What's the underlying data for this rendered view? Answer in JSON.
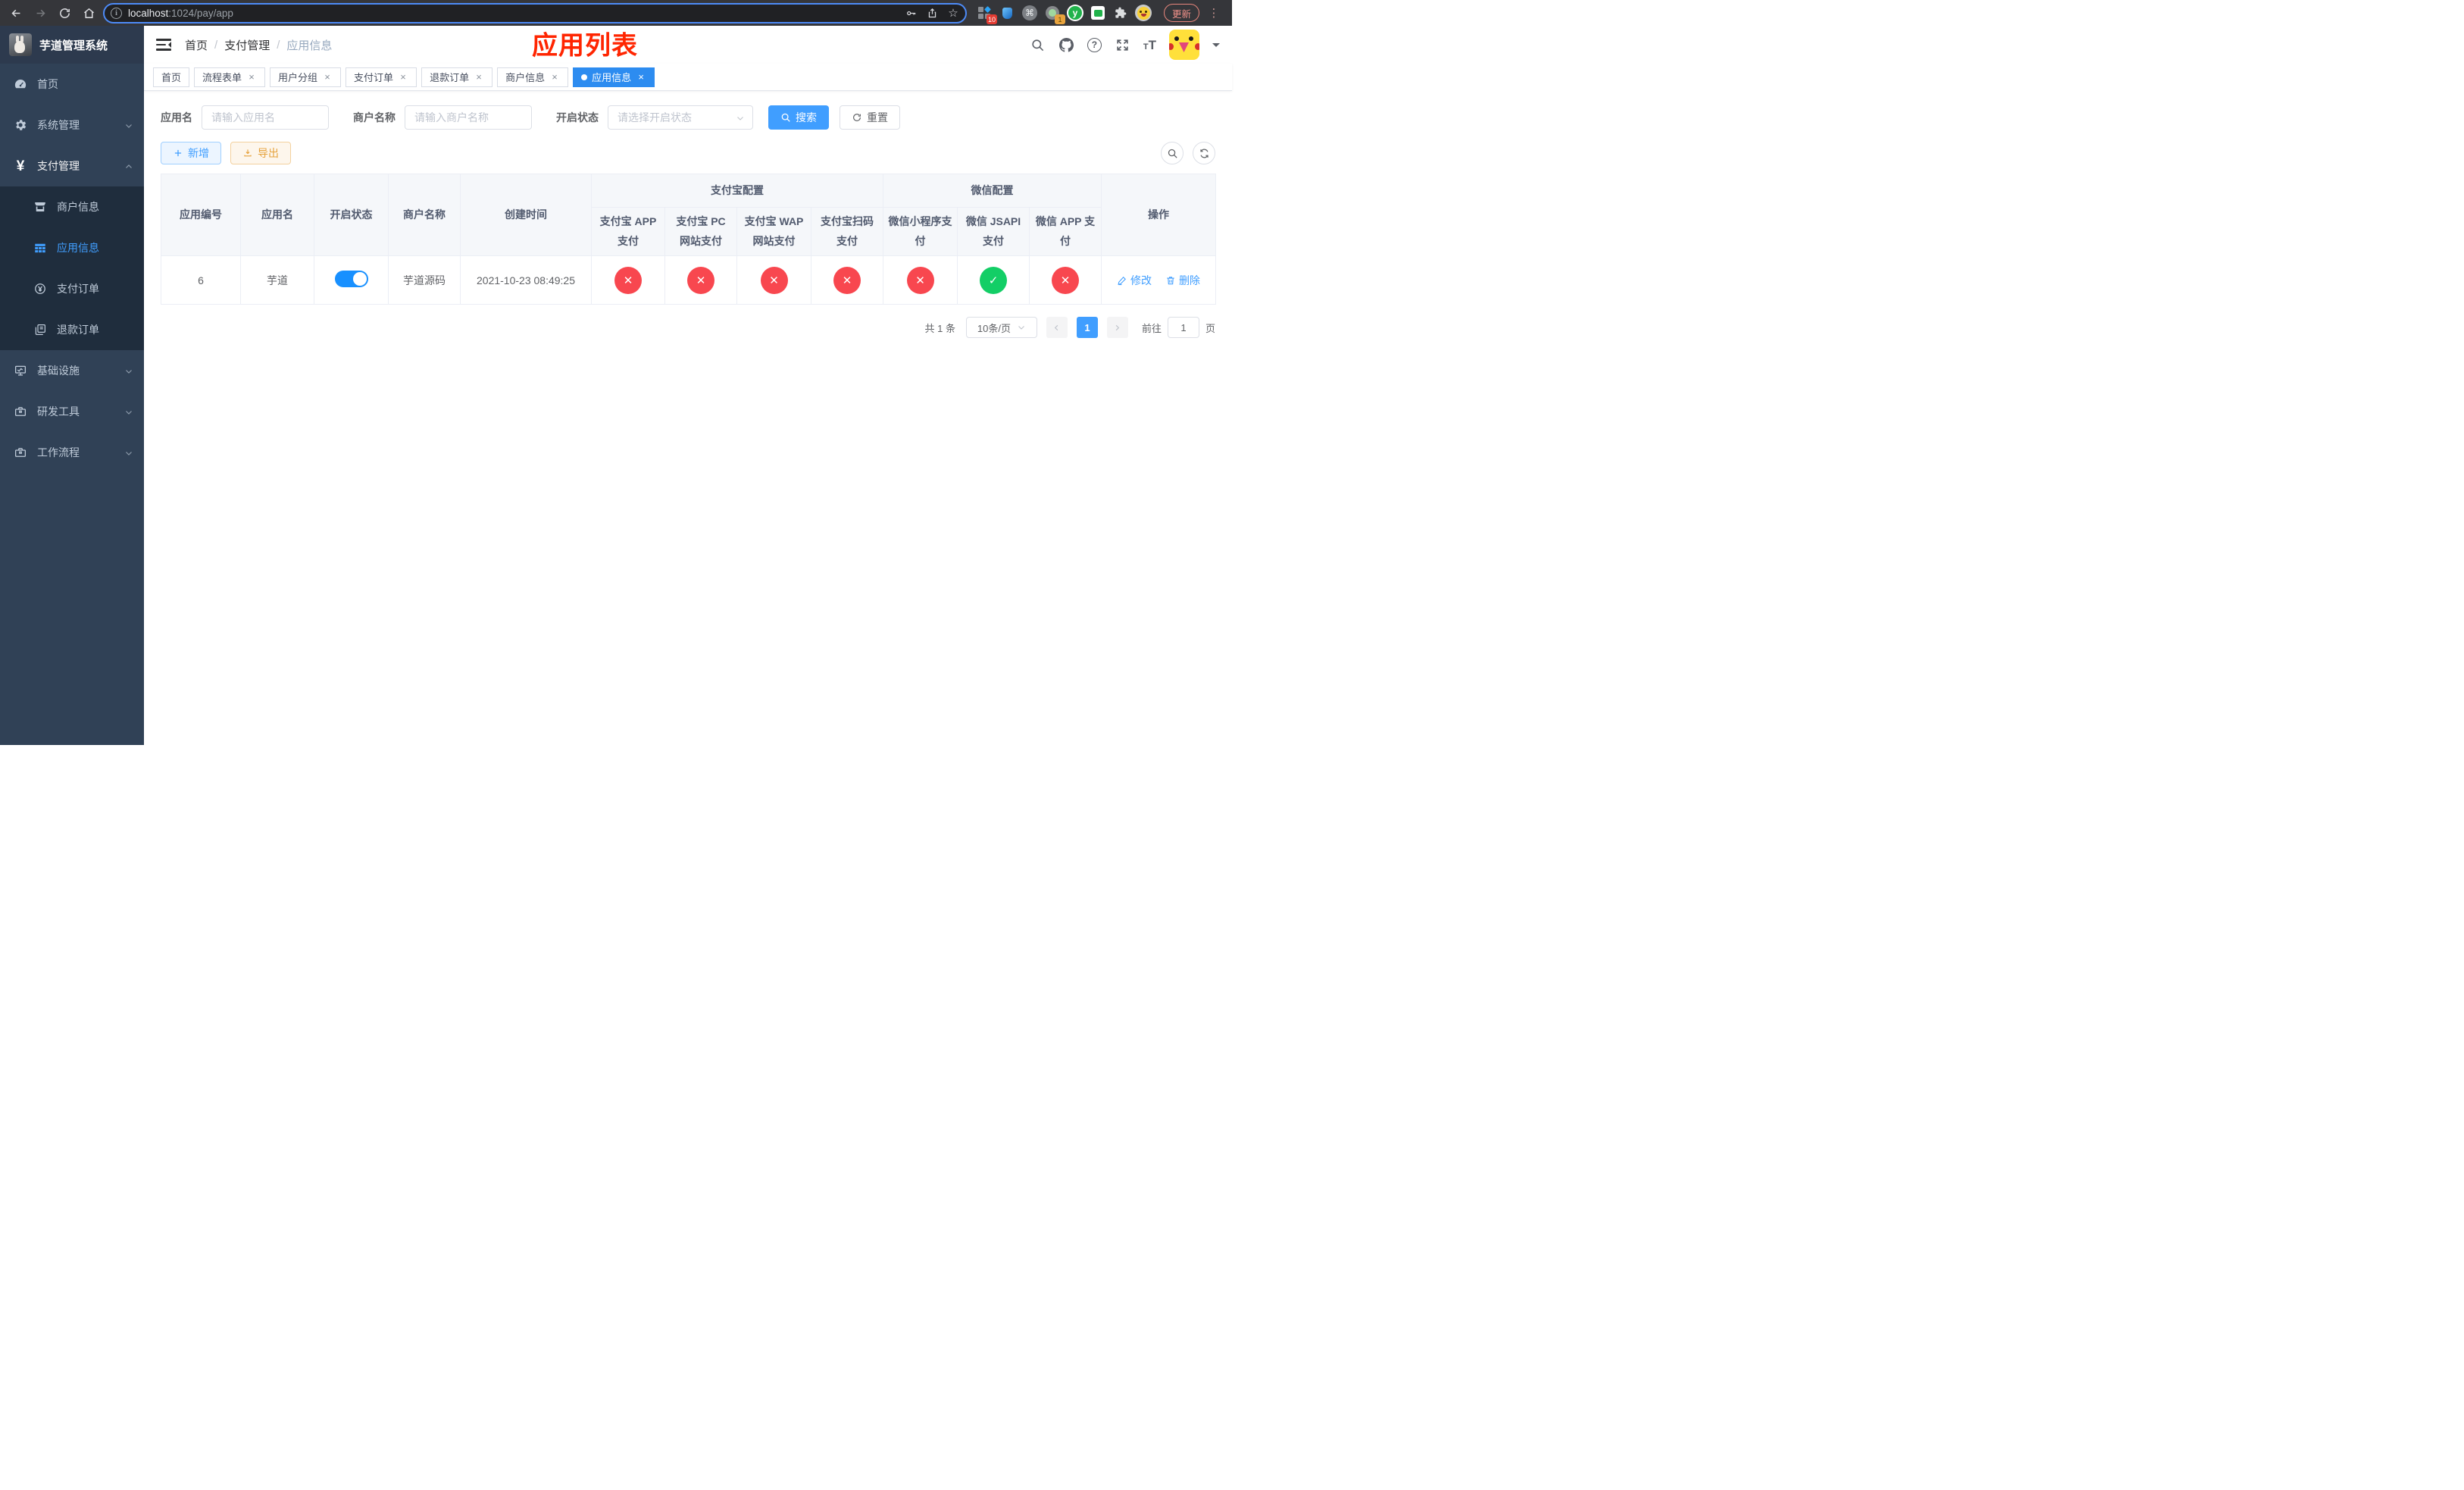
{
  "browser": {
    "url_host": "localhost",
    "url_path": ":1024/pay/app",
    "update_label": "更新",
    "ext_badge_primary": "10",
    "ext_badge_secondary": "1",
    "ext_letter": "y"
  },
  "sidebar": {
    "logo_title": "芋道管理系统",
    "items": [
      {
        "label": "首页",
        "icon": "dashboard-icon"
      },
      {
        "label": "系统管理",
        "icon": "gear-icon"
      },
      {
        "label": "支付管理",
        "icon": "yen-icon",
        "children": [
          {
            "label": "商户信息",
            "icon": "shop-icon"
          },
          {
            "label": "应用信息",
            "icon": "grid-icon",
            "active": true
          },
          {
            "label": "支付订单",
            "icon": "coin-icon"
          },
          {
            "label": "退款订单",
            "icon": "document-icon"
          }
        ]
      },
      {
        "label": "基础设施",
        "icon": "monitor-icon"
      },
      {
        "label": "研发工具",
        "icon": "toolbox-icon"
      },
      {
        "label": "工作流程",
        "icon": "toolbox-icon"
      }
    ]
  },
  "header": {
    "breadcrumb": [
      "首页",
      "支付管理",
      "应用信息"
    ],
    "overlay_title": "应用列表"
  },
  "tabs": [
    {
      "label": "首页",
      "closable": false,
      "active": false
    },
    {
      "label": "流程表单",
      "closable": true,
      "active": false
    },
    {
      "label": "用户分组",
      "closable": true,
      "active": false
    },
    {
      "label": "支付订单",
      "closable": true,
      "active": false
    },
    {
      "label": "退款订单",
      "closable": true,
      "active": false
    },
    {
      "label": "商户信息",
      "closable": true,
      "active": false
    },
    {
      "label": "应用信息",
      "closable": true,
      "active": true
    }
  ],
  "filters": {
    "app_name_label": "应用名",
    "app_name_placeholder": "请输入应用名",
    "merchant_label": "商户名称",
    "merchant_placeholder": "请输入商户名称",
    "status_label": "开启状态",
    "status_placeholder": "请选择开启状态",
    "search_label": "搜索",
    "reset_label": "重置"
  },
  "toolbar": {
    "add_label": "新增",
    "export_label": "导出"
  },
  "table": {
    "simple_headers": [
      "应用编号",
      "应用名",
      "开启状态",
      "商户名称",
      "创建时间"
    ],
    "groups": [
      {
        "label": "支付宝配置",
        "children": [
          "支付宝 APP 支付",
          "支付宝 PC 网站支付",
          "支付宝 WAP 网站支付",
          "支付宝扫码支付"
        ]
      },
      {
        "label": "微信配置",
        "children": [
          "微信小程序支付",
          "微信 JSAPI 支付",
          "微信 APP 支付"
        ]
      }
    ],
    "action_header": "操作",
    "row": {
      "id": "6",
      "name": "芋道",
      "enabled": true,
      "merchant": "芋道源码",
      "created": "2021-10-23 08:49:25",
      "statuses": [
        "no",
        "no",
        "no",
        "no",
        "no",
        "yes",
        "no"
      ],
      "edit_label": "修改",
      "delete_label": "删除"
    }
  },
  "pagination": {
    "total": "共 1 条",
    "page_size": "10条/页",
    "current_page": "1",
    "goto_label": "前往",
    "goto_value": "1",
    "page_unit": "页"
  },
  "colors": {
    "primary": "#409eff",
    "danger": "#f8474f",
    "success": "#13ce66",
    "warning": "#e6a23c",
    "overlay_red": "#ff2501"
  }
}
